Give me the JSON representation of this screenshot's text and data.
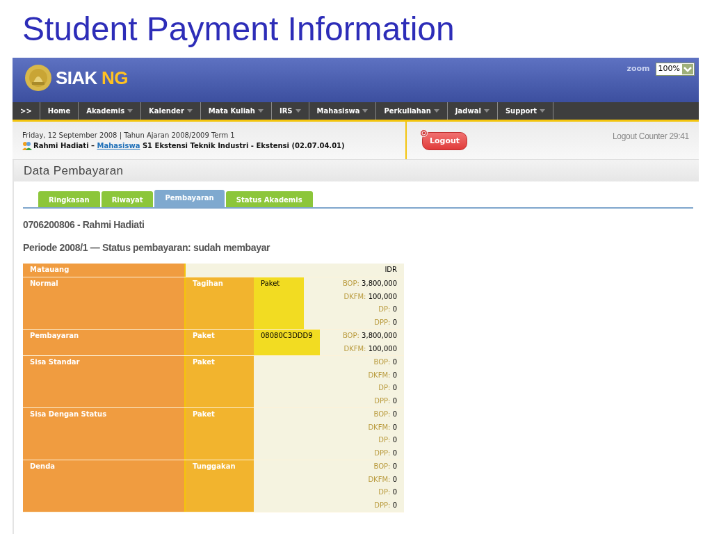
{
  "slide_title": "Student Payment Information",
  "app": {
    "logo": {
      "main": "SIAK",
      "accent": "NG"
    },
    "zoom": {
      "label": "zoom",
      "value": "100%"
    },
    "nav": [
      {
        "label": ">>",
        "dropdown": false
      },
      {
        "label": "Home",
        "dropdown": false
      },
      {
        "label": "Akademis",
        "dropdown": true
      },
      {
        "label": "Kalender",
        "dropdown": true
      },
      {
        "label": "Mata Kuliah",
        "dropdown": true
      },
      {
        "label": "IRS",
        "dropdown": true
      },
      {
        "label": "Mahasiswa",
        "dropdown": true
      },
      {
        "label": "Perkuliahan",
        "dropdown": true
      },
      {
        "label": "Jadwal",
        "dropdown": true
      },
      {
        "label": "Support",
        "dropdown": true
      }
    ],
    "info": {
      "date_line": "Friday, 12 September 2008 | Tahun Ajaran 2008/2009 Term 1",
      "user_name": "Rahmi Hadiati –",
      "role_link": "Mahasiswa",
      "program": "S1 Ekstensi Teknik Industri - Ekstensi (02.07.04.01)"
    },
    "logout": "Logout",
    "logout_counter": "Logout Counter 29:41"
  },
  "section_title": "Data Pembayaran",
  "tabs": [
    {
      "label": "Ringkasan",
      "selected": false
    },
    {
      "label": "Riwayat",
      "selected": false
    },
    {
      "label": "Pembayaran",
      "selected": true
    },
    {
      "label": "Status Akademis",
      "selected": false
    }
  ],
  "student": "0706200806 - Rahmi Hadiati",
  "period": "Periode 2008/1 — Status pembayaran: sudah membayar",
  "table": {
    "currency": {
      "label": "Matauang",
      "value": "IDR"
    },
    "rows": [
      {
        "label": "Normal",
        "type": "Tagihan",
        "code": "Paket",
        "values": [
          {
            "key": "BOP:",
            "value": "3,800,000"
          },
          {
            "key": "DKFM:",
            "value": "100,000"
          },
          {
            "key": "DP:",
            "value": "0"
          },
          {
            "key": "DPP:",
            "value": "0"
          }
        ]
      },
      {
        "label": "Pembayaran",
        "type": "Paket",
        "code": "08080C3DDD9",
        "values": [
          {
            "key": "BOP:",
            "value": "3,800,000"
          },
          {
            "key": "DKFM:",
            "value": "100,000"
          }
        ]
      },
      {
        "label": "Sisa Standar",
        "type": "Paket",
        "values": [
          {
            "key": "BOP:",
            "value": "0"
          },
          {
            "key": "DKFM:",
            "value": "0"
          },
          {
            "key": "DP:",
            "value": "0"
          },
          {
            "key": "DPP:",
            "value": "0"
          }
        ]
      },
      {
        "label": "Sisa Dengan Status",
        "type": "Paket",
        "values": [
          {
            "key": "BOP:",
            "value": "0"
          },
          {
            "key": "DKFM:",
            "value": "0"
          },
          {
            "key": "DP:",
            "value": "0"
          },
          {
            "key": "DPP:",
            "value": "0"
          }
        ]
      },
      {
        "label": "Denda",
        "type": "Tunggakan",
        "values": [
          {
            "key": "BOP:",
            "value": "0"
          },
          {
            "key": "DKFM:",
            "value": "0"
          },
          {
            "key": "DP:",
            "value": "0"
          },
          {
            "key": "DPP:",
            "value": "0"
          }
        ]
      }
    ]
  }
}
